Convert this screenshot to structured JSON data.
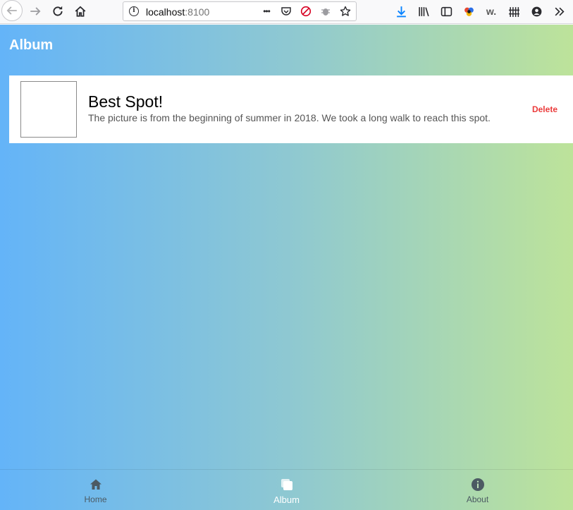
{
  "browser": {
    "url_host": "localhost",
    "url_port": ":8100",
    "more_label": "•••",
    "w_label": "w."
  },
  "app": {
    "title": "Album"
  },
  "card": {
    "title": "Best Spot!",
    "description": "The picture is from the beginning of summer in 2018. We took a long walk to reach this spot.",
    "delete_label": "Delete"
  },
  "tabs": [
    {
      "label": "Home",
      "icon": "home-icon",
      "active": false
    },
    {
      "label": "Album",
      "icon": "images-icon",
      "active": true
    },
    {
      "label": "About",
      "icon": "info-icon",
      "active": false
    }
  ],
  "colors": {
    "gradient_start": "#64b4f8",
    "gradient_end": "#bde39a",
    "delete": "#eb3b3b",
    "tab_inactive": "#4c5a63",
    "tab_active": "#ffffff"
  }
}
